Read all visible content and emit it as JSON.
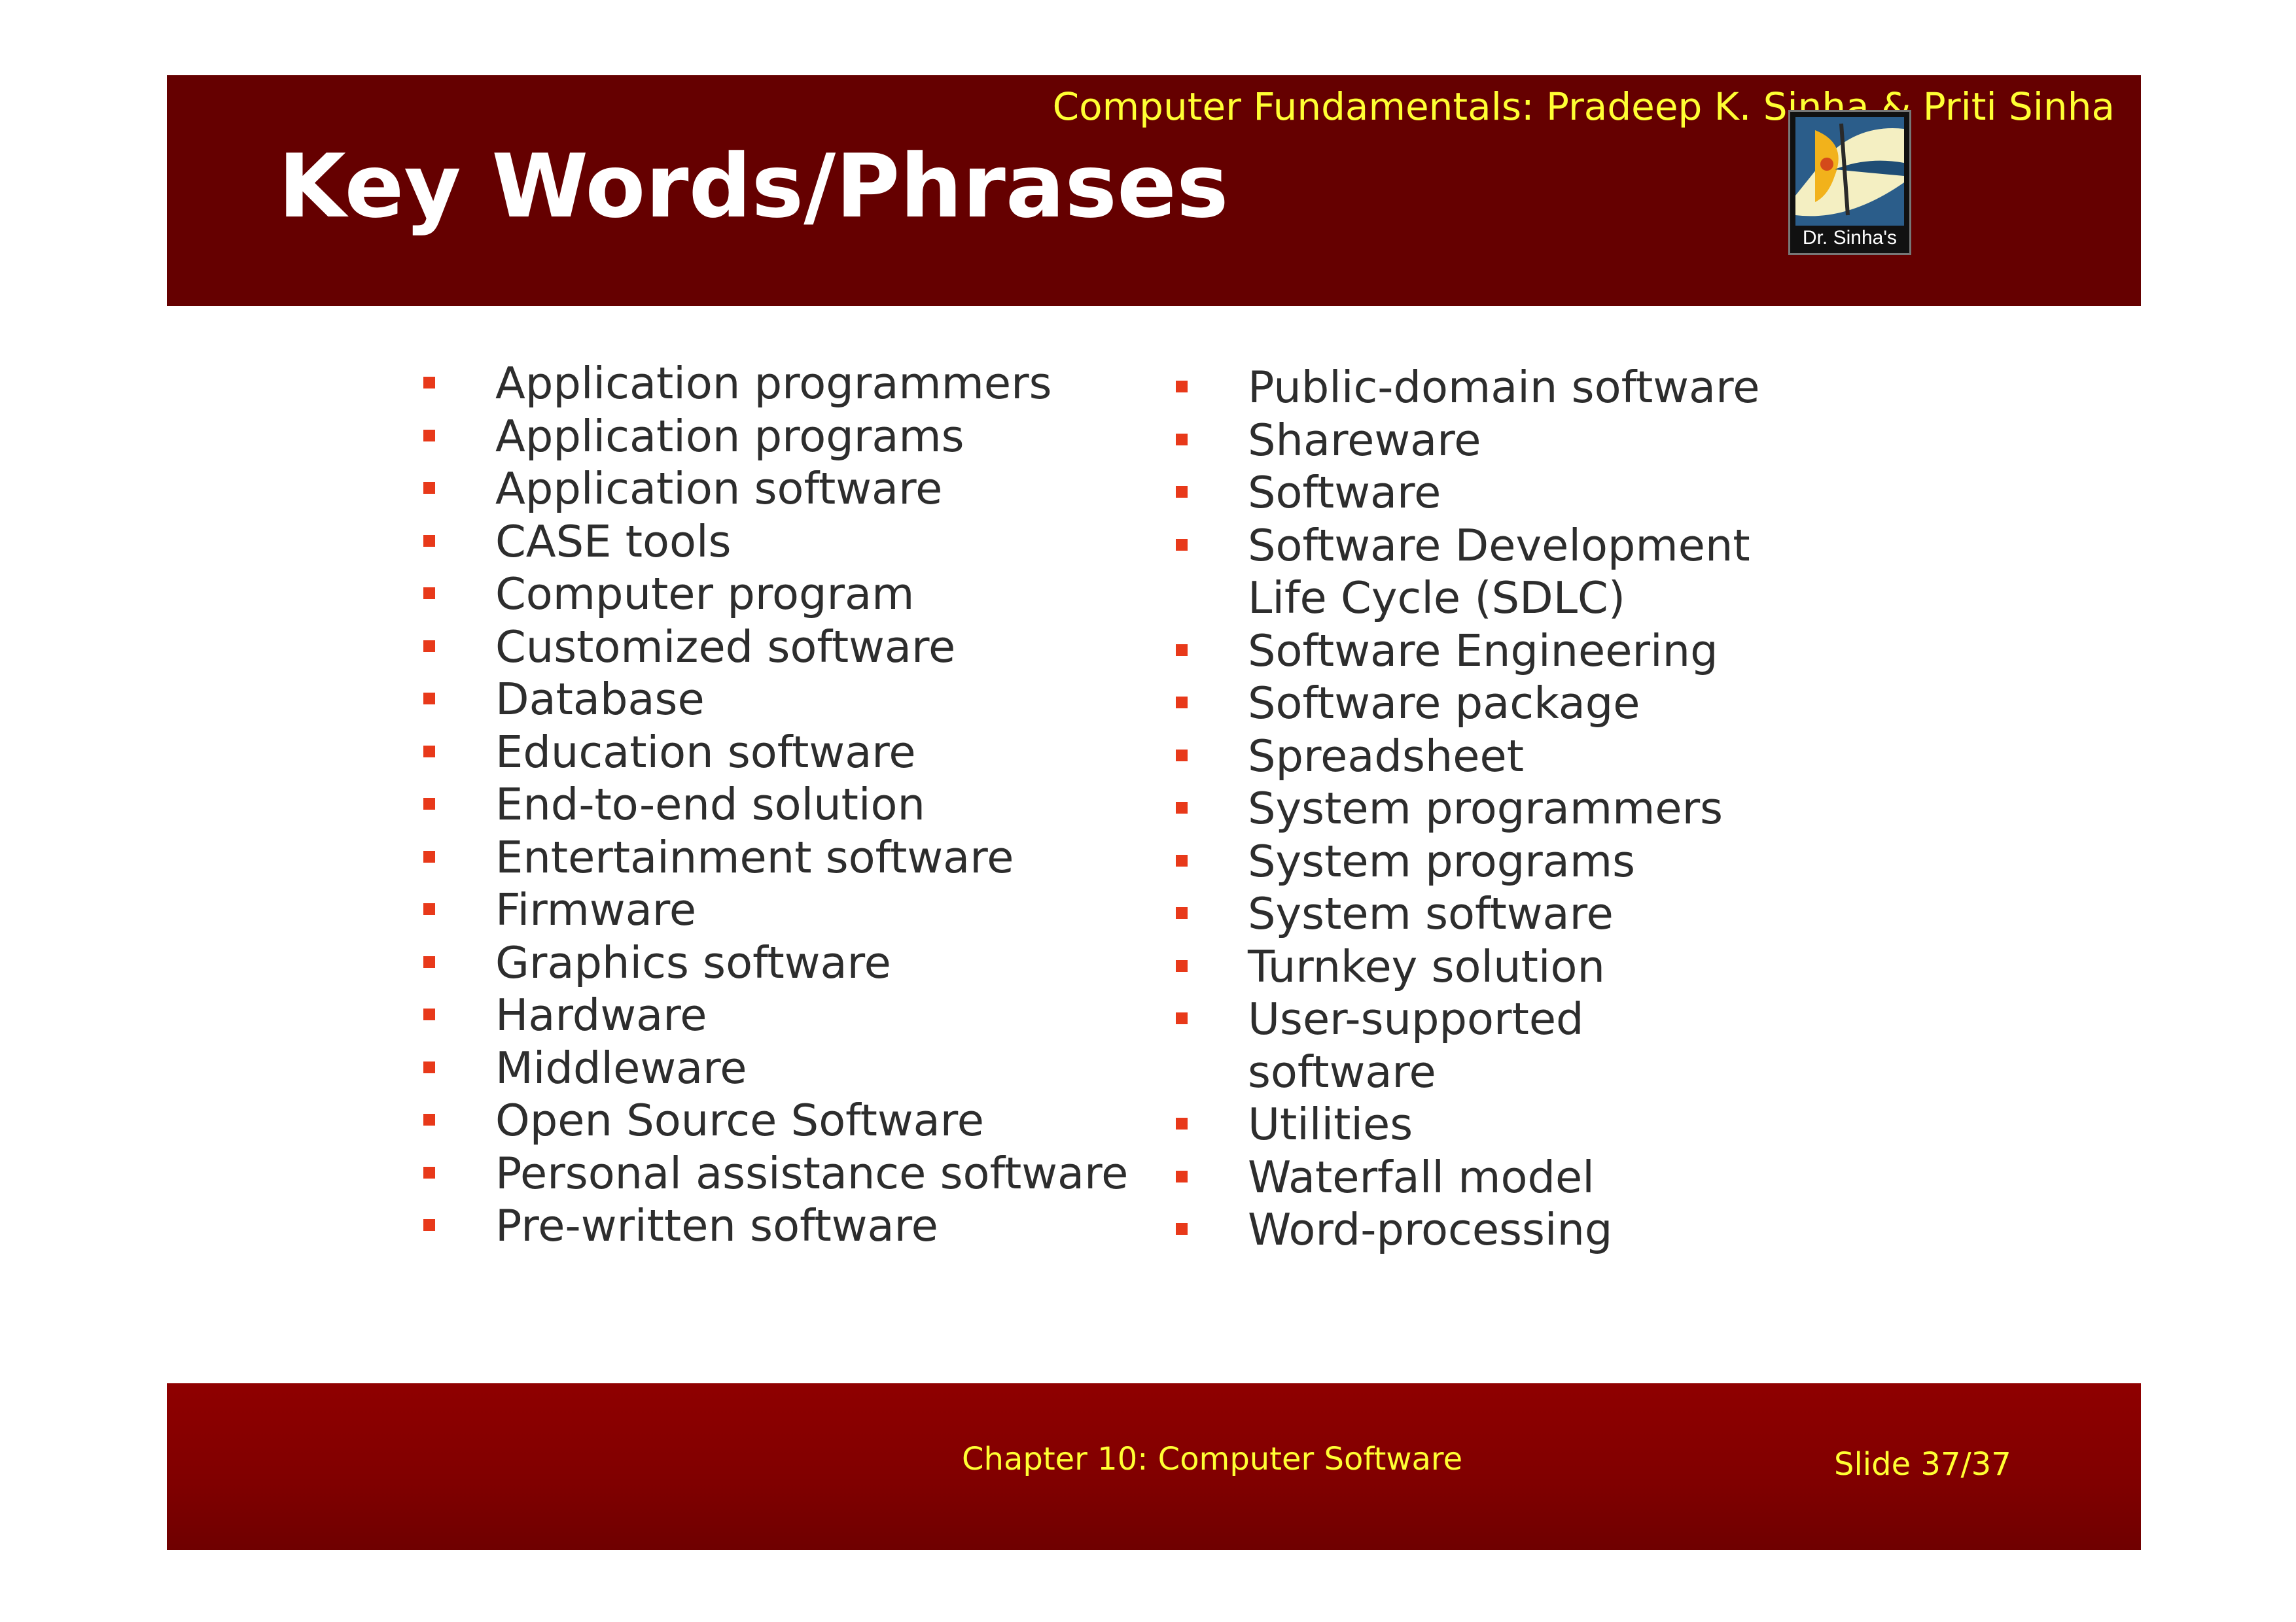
{
  "header": {
    "book_title": "Computer Fundamentals: Pradeep K. Sinha & Priti Sinha",
    "slide_title": "Key Words/Phrases",
    "logo_text": "Dr. Sinha's"
  },
  "keywords": {
    "left": [
      "Application programmers",
      "Application programs",
      "Application software",
      "CASE tools",
      "Computer program",
      "Customized software",
      "Database",
      "Education software",
      "End-to-end solution",
      "Entertainment software",
      "Firmware",
      "Graphics software",
      "Hardware",
      "Middleware",
      "Open Source Software",
      "Personal assistance software",
      "Pre-written software"
    ],
    "right": [
      "Public-domain software",
      "Shareware",
      "Software",
      "Software Development\nLife Cycle (SDLC)",
      "Software Engineering",
      "Software package",
      "Spreadsheet",
      "System programmers",
      "System programs",
      "System software",
      "Turnkey solution",
      "User-supported\nsoftware",
      "Utilities",
      "Waterfall model",
      "Word-processing"
    ]
  },
  "footer": {
    "chapter": "Chapter 10: Computer Software",
    "slide_number": "Slide 37/37"
  }
}
